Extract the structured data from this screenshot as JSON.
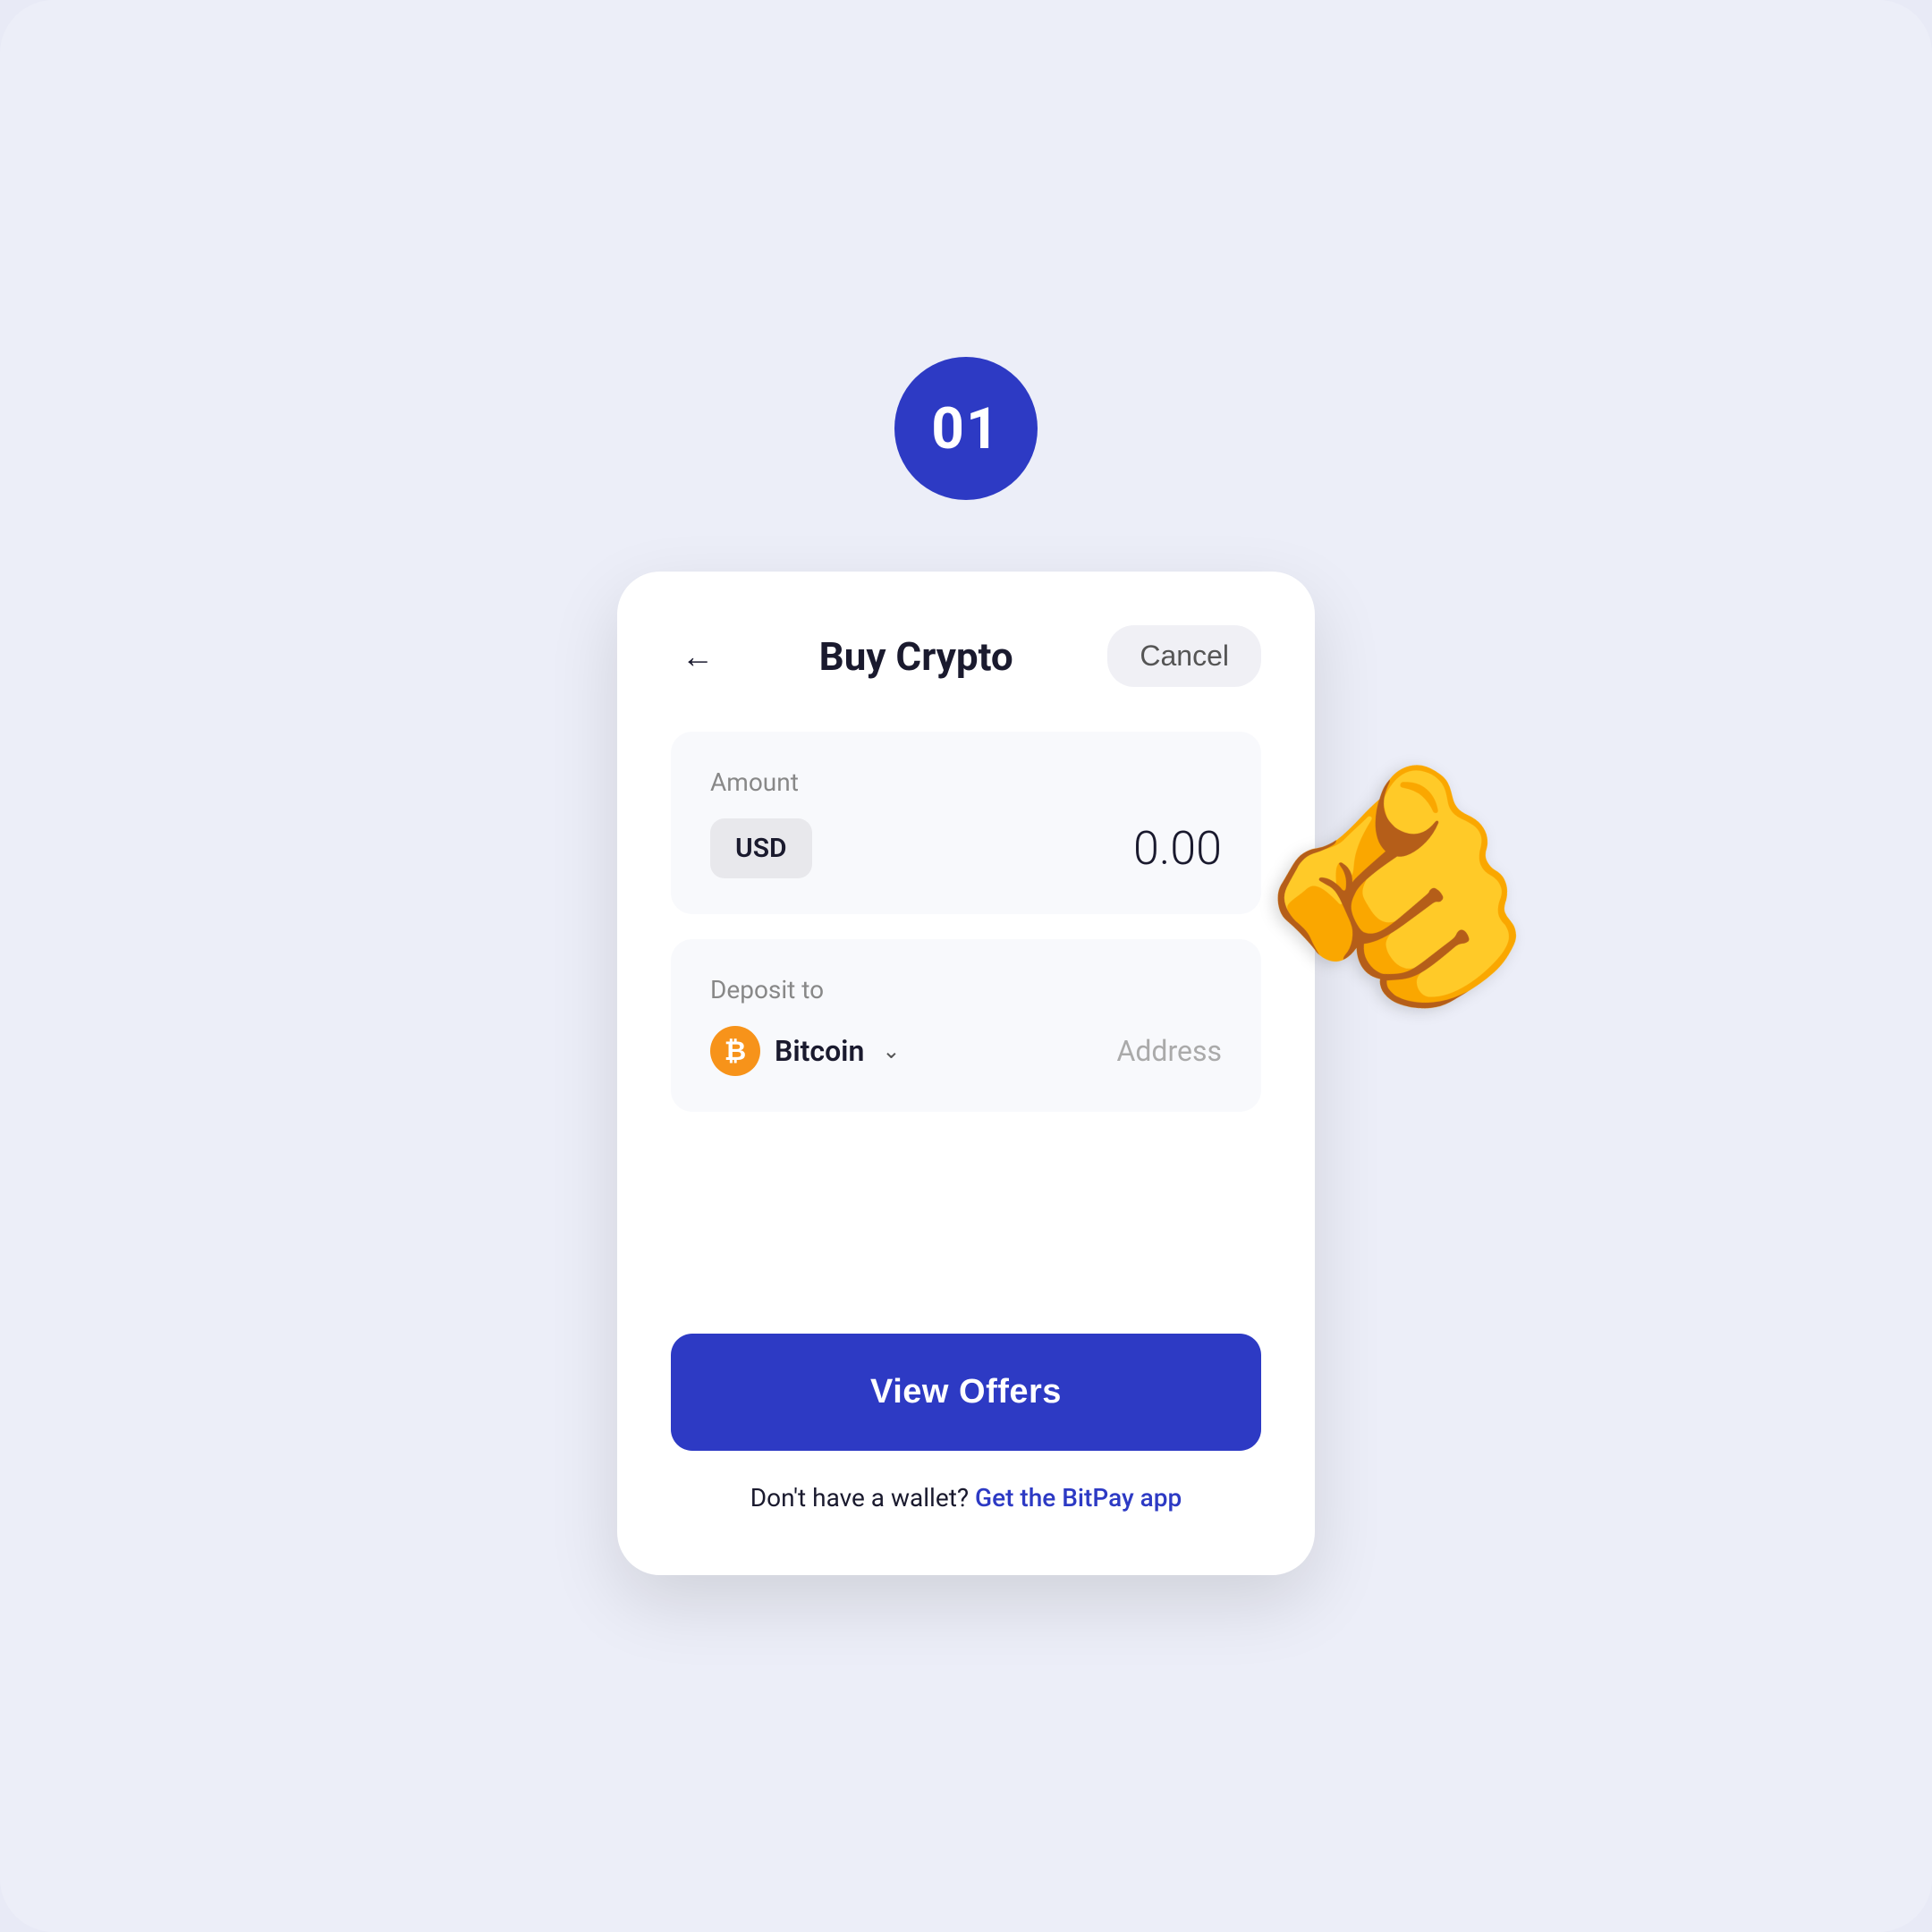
{
  "page": {
    "background_color": "#eceef8",
    "step_number": "01"
  },
  "header": {
    "title": "Buy Crypto",
    "cancel_label": "Cancel"
  },
  "amount_section": {
    "label": "Amount",
    "currency": "USD",
    "value": "0.00"
  },
  "deposit_section": {
    "label": "Deposit to",
    "crypto_name": "Bitcoin",
    "address_placeholder": "Address"
  },
  "actions": {
    "view_offers_label": "View Offers"
  },
  "footer": {
    "text": "Don't have a wallet?",
    "link_text": "Get the BitPay app"
  },
  "icons": {
    "back_arrow": "←",
    "chevron_down": "⌄",
    "bitcoin_symbol": "₿"
  }
}
